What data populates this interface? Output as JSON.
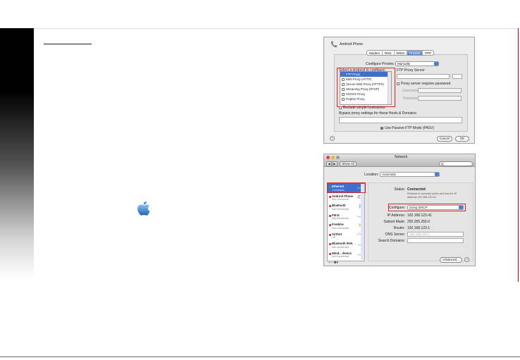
{
  "proxies_window": {
    "title": "Android Phone",
    "tabs": [
      {
        "label": "Modem",
        "active": false
      },
      {
        "label": "DNS",
        "active": false
      },
      {
        "label": "WINS",
        "active": false
      },
      {
        "label": "Proxies",
        "active": true
      },
      {
        "label": "PPP",
        "active": false
      }
    ],
    "configure_label": "Configure Proxies:",
    "configure_value": "Manually",
    "protocol_label": "Select a protocol to configure:",
    "protocols": [
      {
        "label": "FTP Proxy",
        "checked": true,
        "selected": true
      },
      {
        "label": "Web Proxy (HTTP)",
        "checked": false,
        "selected": false
      },
      {
        "label": "Secure Web Proxy (HTTPS)",
        "checked": false,
        "selected": false
      },
      {
        "label": "Streaming Proxy (RTSP)",
        "checked": false,
        "selected": false
      },
      {
        "label": "SOCKS Proxy",
        "checked": false,
        "selected": false
      },
      {
        "label": "Gopher Proxy",
        "checked": false,
        "selected": false
      }
    ],
    "server_label": "FTP Proxy Server",
    "password_required_label": "Proxy server requires password",
    "username_label": "Username:",
    "password_label": "Password:",
    "exclude_label": "Exclude simple hostnames",
    "bypass_label": "Bypass proxy settings for these Hosts & Domains:",
    "pasv_label": "Use Passive FTP Mode (PASV)",
    "cancel_label": "Cancel",
    "ok_label": "OK",
    "help_label": "?"
  },
  "network_window": {
    "title": "Network",
    "back_label": "◀",
    "forward_label": "▶",
    "show_all_label": "Show All",
    "search_icon_label": "Q",
    "location_label": "Location:",
    "location_value": "Automatic",
    "services": [
      {
        "name": "Ethernet",
        "status": "Connected",
        "color": "#2fb52f",
        "icon": "↔",
        "selected": true
      },
      {
        "name": "Android Phone",
        "status": "Not Connected",
        "color": "#d22020",
        "icon": "✆",
        "selected": false
      },
      {
        "name": "Bluetooth",
        "status": "Not Connected",
        "color": "#d22020",
        "icon": "ᛒ",
        "selected": false
      },
      {
        "name": "FW-E",
        "status": "Not Connected",
        "color": "#d22020",
        "icon": "↔",
        "selected": false
      },
      {
        "name": "FireWire",
        "status": "Not Connected",
        "color": "#d22020",
        "icon": "Y",
        "selected": false
      },
      {
        "name": "AirPort",
        "status": "Off",
        "color": "#d22020",
        "icon": "◠",
        "selected": false
      },
      {
        "name": "Bluetooth PAN",
        "status": "Not Connected",
        "color": "#d22020",
        "icon": "↔",
        "selected": false
      },
      {
        "name": "Wind... device",
        "status": "Not Connected",
        "color": "#d22020",
        "icon": "↔",
        "selected": false
      }
    ],
    "list_tools": "+  −  ✱▾",
    "status_label": "Status:",
    "status_value": "Connected",
    "status_desc_1": "Ethernet is currently active and has the IP",
    "status_desc_2": "address 192.168.123.41.",
    "configure_label": "Configure:",
    "configure_value": "Using DHCP",
    "ip_label": "IP Address:",
    "ip_value": "192.168.123.41",
    "subnet_label": "Subnet Mask:",
    "subnet_value": "255.255.255.0",
    "router_label": "Router:",
    "router_value": "192.168.123.1",
    "dns_label": "DNS Server:",
    "dns_value": "192.168.123.1",
    "search_domains_label": "Search Domains:",
    "advanced_label": "Advanced...",
    "help_label": "?"
  }
}
